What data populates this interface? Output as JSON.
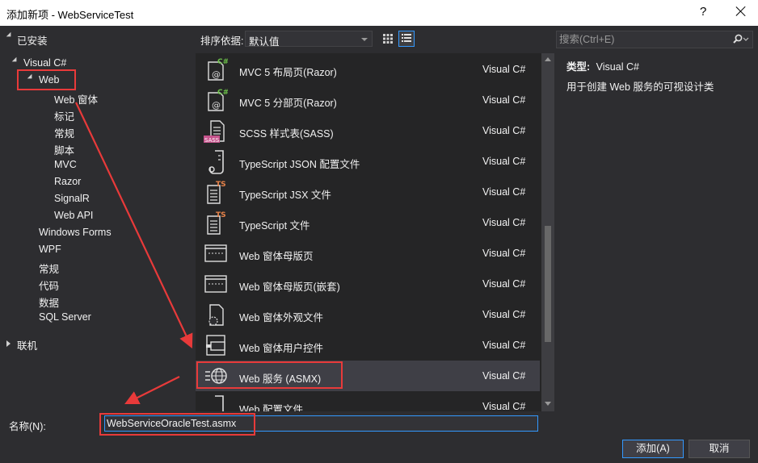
{
  "window": {
    "title": "添加新项 - WebServiceTest",
    "help_glyph": "?"
  },
  "tree": {
    "installed": "已安装",
    "visual_csharp": "Visual C#",
    "web": "Web",
    "web_children": [
      "Web 窗体",
      "标记",
      "常规",
      "脚本",
      "MVC",
      "Razor",
      "SignalR",
      "Web API"
    ],
    "csharp_children": [
      "Windows Forms",
      "WPF",
      "常规",
      "代码",
      "数据",
      "SQL Server"
    ],
    "online": "联机"
  },
  "toolbar": {
    "sort_label": "排序依据:",
    "sort_value": "默认值"
  },
  "items": [
    {
      "name": "MVC 5 布局页(Razor)",
      "lang": "Visual C#",
      "icon": "razor-layout-icon"
    },
    {
      "name": "MVC 5 分部页(Razor)",
      "lang": "Visual C#",
      "icon": "razor-partial-icon"
    },
    {
      "name": "SCSS 样式表(SASS)",
      "lang": "Visual C#",
      "icon": "scss-file-icon"
    },
    {
      "name": "TypeScript JSON 配置文件",
      "lang": "Visual C#",
      "icon": "json-config-icon"
    },
    {
      "name": "TypeScript JSX 文件",
      "lang": "Visual C#",
      "icon": "ts-jsx-file-icon"
    },
    {
      "name": "TypeScript 文件",
      "lang": "Visual C#",
      "icon": "ts-file-icon"
    },
    {
      "name": "Web 窗体母版页",
      "lang": "Visual C#",
      "icon": "master-page-icon"
    },
    {
      "name": "Web 窗体母版页(嵌套)",
      "lang": "Visual C#",
      "icon": "nested-master-page-icon"
    },
    {
      "name": "Web 窗体外观文件",
      "lang": "Visual C#",
      "icon": "skin-file-icon"
    },
    {
      "name": "Web 窗体用户控件",
      "lang": "Visual C#",
      "icon": "user-control-icon"
    },
    {
      "name": "Web 服务 (ASMX)",
      "lang": "Visual C#",
      "icon": "web-service-globe-icon",
      "selected": true
    },
    {
      "name": "Web 配置文件",
      "lang": "Visual C#",
      "icon": "web-config-icon"
    }
  ],
  "search": {
    "placeholder": "搜索(Ctrl+E)"
  },
  "details": {
    "type_label": "类型:",
    "type_value": "Visual C#",
    "description": "用于创建 Web 服务的可视设计类"
  },
  "bottom": {
    "name_label": "名称(N):",
    "name_value": "WebServiceOracleTest.asmx",
    "add_button": "添加(A)",
    "cancel_button": "取消"
  },
  "colors": {
    "annotation_red": "#e83a3a",
    "accent_blue": "#3399ff",
    "selected_row": "#3f3f46"
  }
}
